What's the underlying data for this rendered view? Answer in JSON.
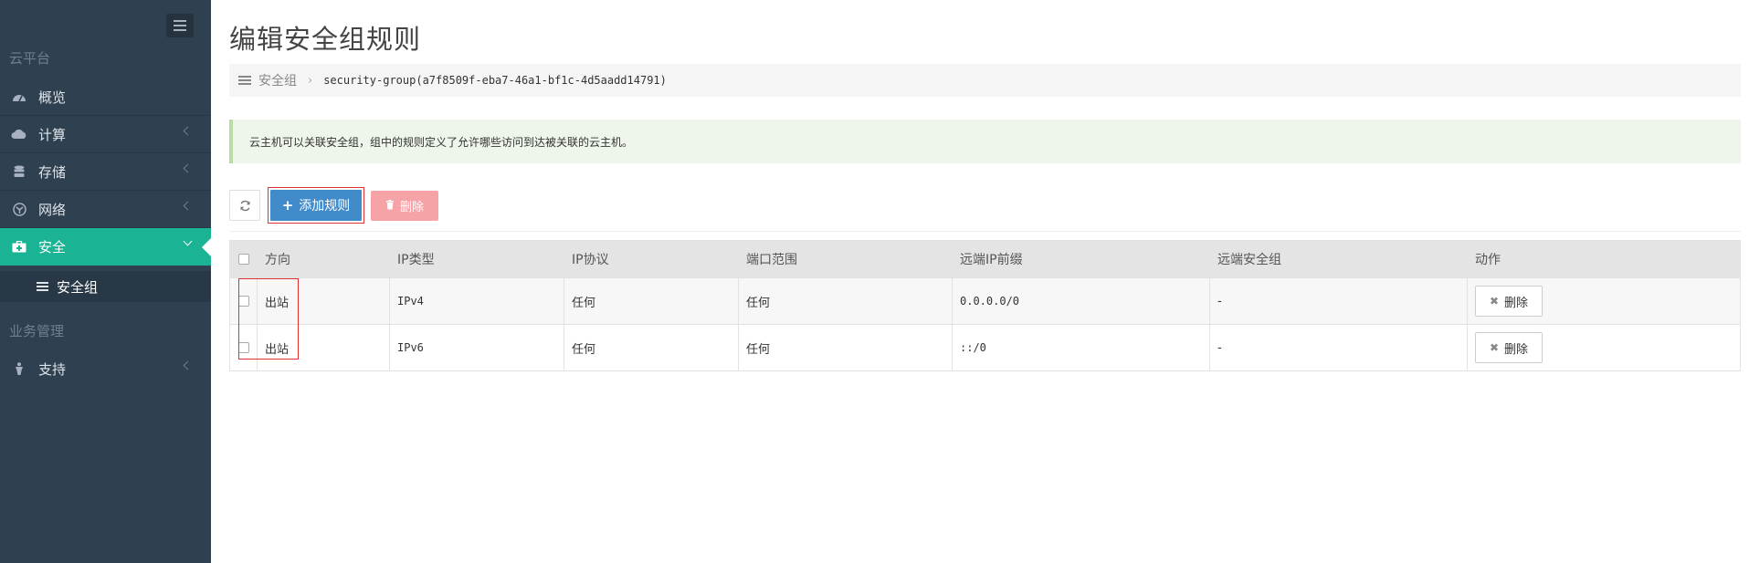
{
  "sidebar": {
    "sections": [
      {
        "label": "云平台"
      },
      {
        "label": "业务管理"
      }
    ],
    "items": [
      {
        "label": "概览",
        "icon": "dashboard-icon"
      },
      {
        "label": "计算",
        "icon": "cloud-icon"
      },
      {
        "label": "存储",
        "icon": "database-icon"
      },
      {
        "label": "网络",
        "icon": "network-icon"
      },
      {
        "label": "安全",
        "icon": "medkit-icon"
      },
      {
        "label": "支持",
        "icon": "support-icon"
      }
    ],
    "subitem": {
      "label": "安全组",
      "icon": "list-icon"
    }
  },
  "page": {
    "title": "编辑安全组规则"
  },
  "breadcrumb": {
    "parent": "安全组",
    "current": "security-group(a7f8509f-eba7-46a1-bf1c-4d5aadd14791)"
  },
  "alert": {
    "text": "云主机可以关联安全组，组中的规则定义了允许哪些访问到达被关联的云主机。"
  },
  "toolbar": {
    "add_label": "添加规则",
    "delete_label": "删除"
  },
  "table": {
    "headers": [
      "方向",
      "IP类型",
      "IP协议",
      "端口范围",
      "远端IP前缀",
      "远端安全组",
      "动作"
    ],
    "rows": [
      {
        "direction": "出站",
        "ip_type": "IPv4",
        "protocol": "任何",
        "port_range": "任何",
        "remote_ip": "0.0.0.0/0",
        "remote_sg": "-",
        "action": "删除"
      },
      {
        "direction": "出站",
        "ip_type": "IPv6",
        "protocol": "任何",
        "port_range": "任何",
        "remote_ip": "::/0",
        "remote_sg": "-",
        "action": "删除"
      }
    ]
  },
  "colors": {
    "sidebar_bg": "#2f4050",
    "active_item": "#1ab394",
    "primary_button": "#428bca",
    "danger_button": "#f6a3a8",
    "highlight_box": "#e03030"
  }
}
